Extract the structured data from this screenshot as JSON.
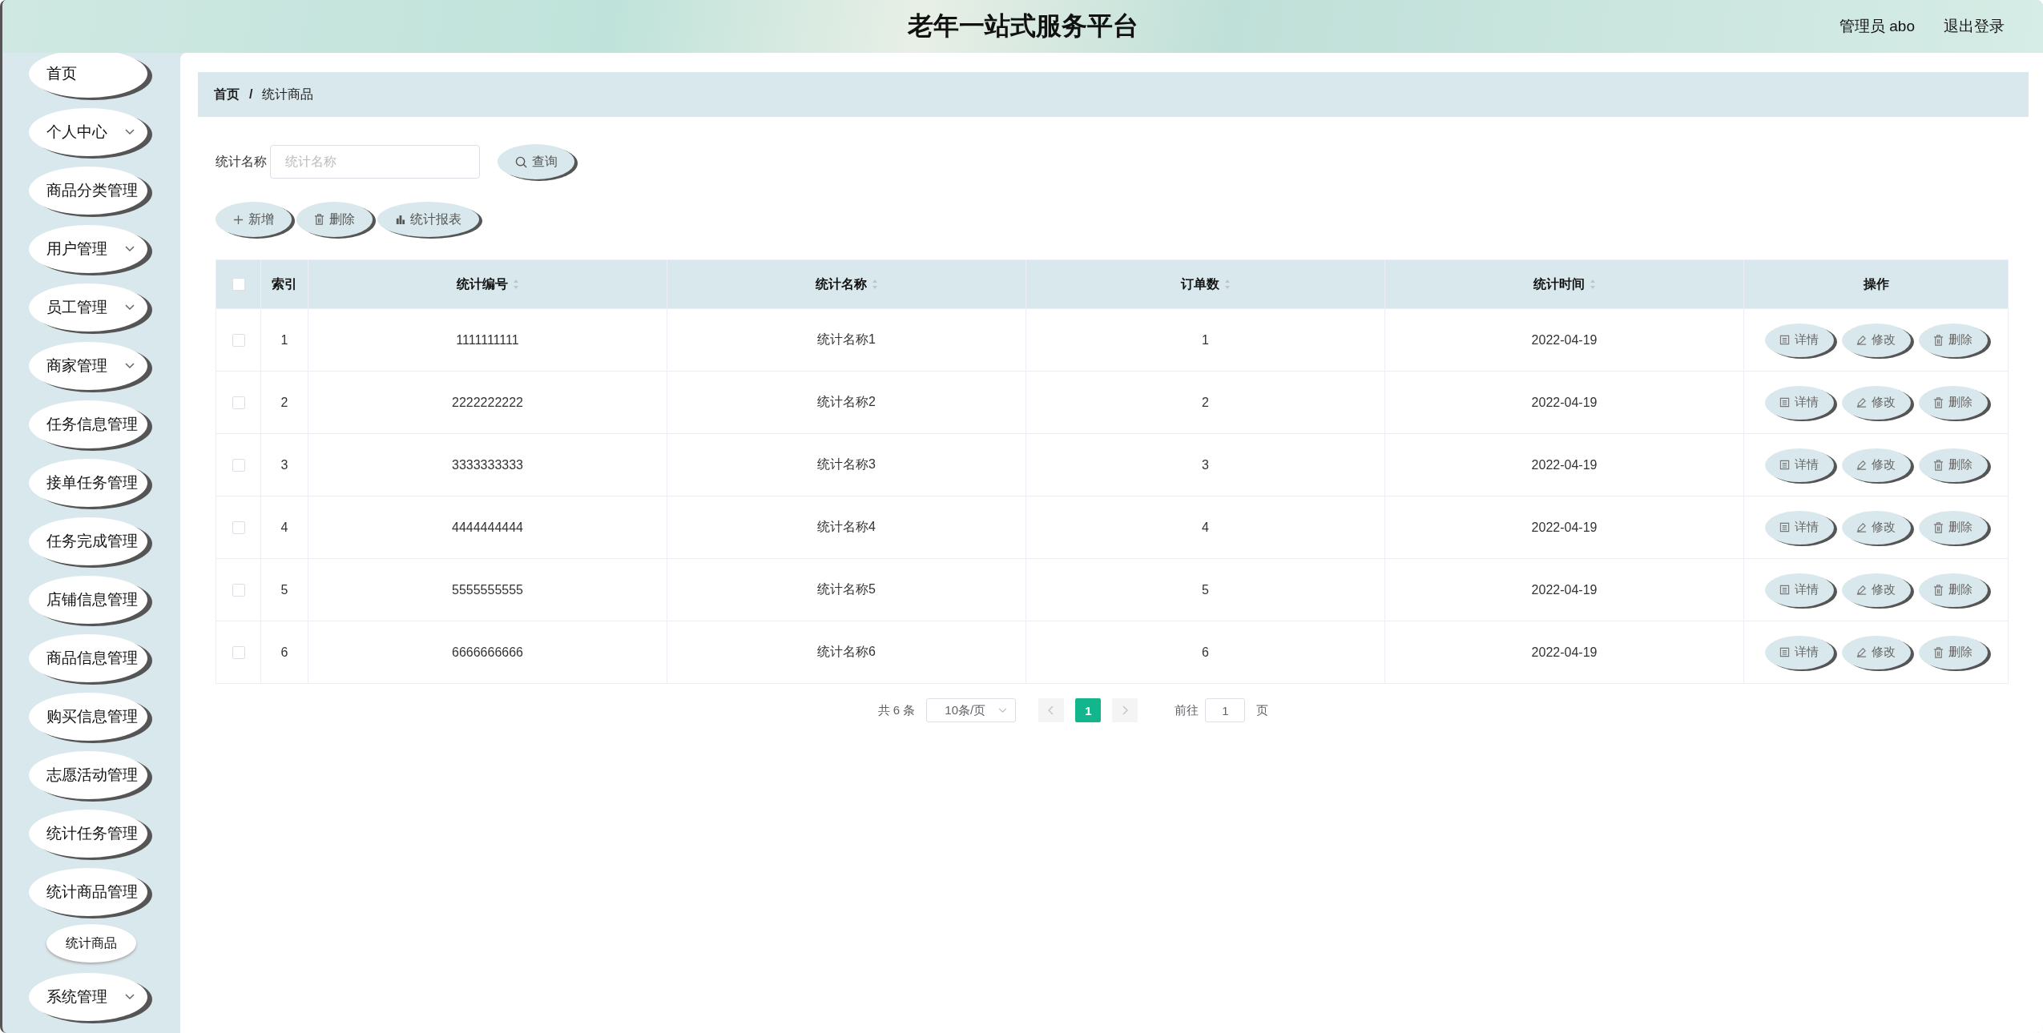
{
  "header": {
    "title": "老年一站式服务平台",
    "user": "管理员 abo",
    "logout": "退出登录"
  },
  "sidebar": {
    "items": [
      {
        "label": "首页",
        "kind": "link"
      },
      {
        "label": "个人中心",
        "kind": "submenu"
      },
      {
        "label": "商品分类管理",
        "kind": "link"
      },
      {
        "label": "用户管理",
        "kind": "submenu"
      },
      {
        "label": "员工管理",
        "kind": "submenu"
      },
      {
        "label": "商家管理",
        "kind": "submenu"
      },
      {
        "label": "任务信息管理",
        "kind": "link"
      },
      {
        "label": "接单任务管理",
        "kind": "link"
      },
      {
        "label": "任务完成管理",
        "kind": "link"
      },
      {
        "label": "店铺信息管理",
        "kind": "link"
      },
      {
        "label": "商品信息管理",
        "kind": "link"
      },
      {
        "label": "购买信息管理",
        "kind": "link"
      },
      {
        "label": "志愿活动管理",
        "kind": "link"
      },
      {
        "label": "统计任务管理",
        "kind": "link"
      },
      {
        "label": "统计商品管理",
        "kind": "link",
        "children": [
          {
            "label": "统计商品"
          }
        ]
      },
      {
        "label": "系统管理",
        "kind": "submenu"
      }
    ]
  },
  "breadcrumb": [
    "首页",
    "统计商品"
  ],
  "breadcrumb_separator": "/",
  "search": {
    "label": "统计名称",
    "placeholder": "统计名称",
    "button": "查询"
  },
  "toolbar": [
    {
      "label": "新增",
      "kind": "add"
    },
    {
      "label": "删除",
      "kind": "delete"
    },
    {
      "label": "统计报表",
      "kind": "chart"
    }
  ],
  "table": {
    "select_all_checked": false,
    "columns": [
      {
        "label": "索引",
        "sortable": false
      },
      {
        "label": "统计编号",
        "sortable": true
      },
      {
        "label": "统计名称",
        "sortable": true
      },
      {
        "label": "订单数",
        "sortable": true
      },
      {
        "label": "统计时间",
        "sortable": true
      },
      {
        "label": "操作",
        "sortable": false
      }
    ],
    "rows": [
      {
        "checked": false,
        "cells": [
          "1",
          "1111111111",
          "统计名称1",
          "1",
          "2022-04-19"
        ],
        "actions": [
          {
            "label": "详情",
            "kind": "detail"
          },
          {
            "label": "修改",
            "kind": "edit"
          },
          {
            "label": "删除",
            "kind": "delete"
          }
        ]
      },
      {
        "checked": false,
        "cells": [
          "2",
          "2222222222",
          "统计名称2",
          "2",
          "2022-04-19"
        ],
        "actions": [
          {
            "label": "详情",
            "kind": "detail"
          },
          {
            "label": "修改",
            "kind": "edit"
          },
          {
            "label": "删除",
            "kind": "delete"
          }
        ]
      },
      {
        "checked": false,
        "cells": [
          "3",
          "3333333333",
          "统计名称3",
          "3",
          "2022-04-19"
        ],
        "actions": [
          {
            "label": "详情",
            "kind": "detail"
          },
          {
            "label": "修改",
            "kind": "edit"
          },
          {
            "label": "删除",
            "kind": "delete"
          }
        ]
      },
      {
        "checked": false,
        "cells": [
          "4",
          "4444444444",
          "统计名称4",
          "4",
          "2022-04-19"
        ],
        "actions": [
          {
            "label": "详情",
            "kind": "detail"
          },
          {
            "label": "修改",
            "kind": "edit"
          },
          {
            "label": "删除",
            "kind": "delete"
          }
        ]
      },
      {
        "checked": false,
        "cells": [
          "5",
          "5555555555",
          "统计名称5",
          "5",
          "2022-04-19"
        ],
        "actions": [
          {
            "label": "详情",
            "kind": "detail"
          },
          {
            "label": "修改",
            "kind": "edit"
          },
          {
            "label": "删除",
            "kind": "delete"
          }
        ]
      },
      {
        "checked": false,
        "cells": [
          "6",
          "6666666666",
          "统计名称6",
          "6",
          "2022-04-19"
        ],
        "actions": [
          {
            "label": "详情",
            "kind": "detail"
          },
          {
            "label": "修改",
            "kind": "edit"
          },
          {
            "label": "删除",
            "kind": "delete"
          }
        ]
      }
    ]
  },
  "pagination": {
    "total": "共 6 条",
    "page_size": "10条/页",
    "pages": [
      {
        "label": "1",
        "selected": true
      }
    ],
    "goto_label": "前往",
    "goto_value": "1",
    "goto_suffix": "页"
  }
}
